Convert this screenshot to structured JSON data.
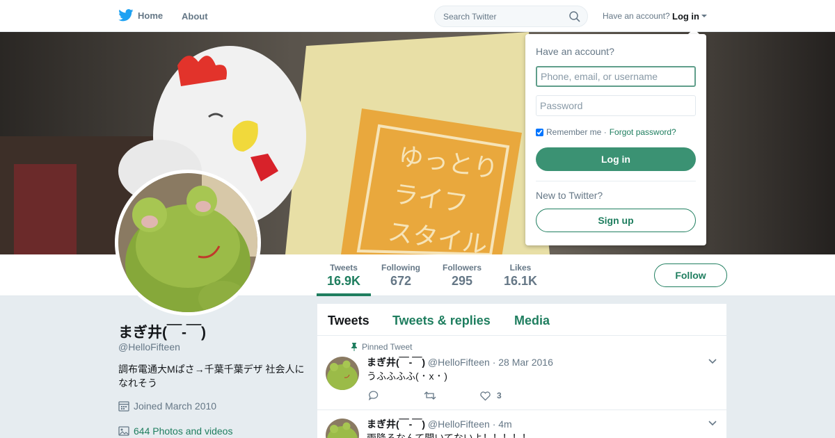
{
  "nav": {
    "home_label": "Home",
    "about_label": "About",
    "search_placeholder": "Search Twitter",
    "have_account": "Have an account?",
    "login_label": "Log in"
  },
  "banner": {
    "sign_text_lines": [
      "ゆっとり",
      "ライフ",
      "スタイル"
    ]
  },
  "stats": [
    {
      "label": "Tweets",
      "value": "16.9K",
      "active": true
    },
    {
      "label": "Following",
      "value": "672"
    },
    {
      "label": "Followers",
      "value": "295"
    },
    {
      "label": "Likes",
      "value": "16.1K"
    }
  ],
  "follow_label": "Follow",
  "profile": {
    "name": "まぎ井(￣-￣)",
    "handle": "@HelloFifteen",
    "bio": "調布電通大Mぱさ→千葉千葉デザ 社会人になれそう",
    "joined": "Joined March 2010",
    "photos": "644 Photos and videos"
  },
  "timeline": {
    "tabs": [
      "Tweets",
      "Tweets & replies",
      "Media"
    ],
    "pinned_label": "Pinned Tweet",
    "tweets": [
      {
        "name": "まぎ井(￣-￣)",
        "handle": "@HelloFifteen",
        "date": "· 28 Mar 2016",
        "text": "うふふふふ( ･ x ･ )",
        "likes": "3"
      },
      {
        "name": "まぎ井(￣-￣)",
        "handle": "@HelloFifteen",
        "date": "· 4m",
        "text": "雨降るなんて聞いてないよ！！！！！"
      }
    ]
  },
  "login_dropdown": {
    "title": "Have an account?",
    "username_placeholder": "Phone, email, or username",
    "password_placeholder": "Password",
    "remember_label": "Remember me ·",
    "forgot_label": "Forgot password?",
    "login_button": "Log in",
    "new_label": "New to Twitter?",
    "signup_button": "Sign up"
  },
  "colors": {
    "accent": "#1f7e5f",
    "login_button": "#3b9273"
  }
}
